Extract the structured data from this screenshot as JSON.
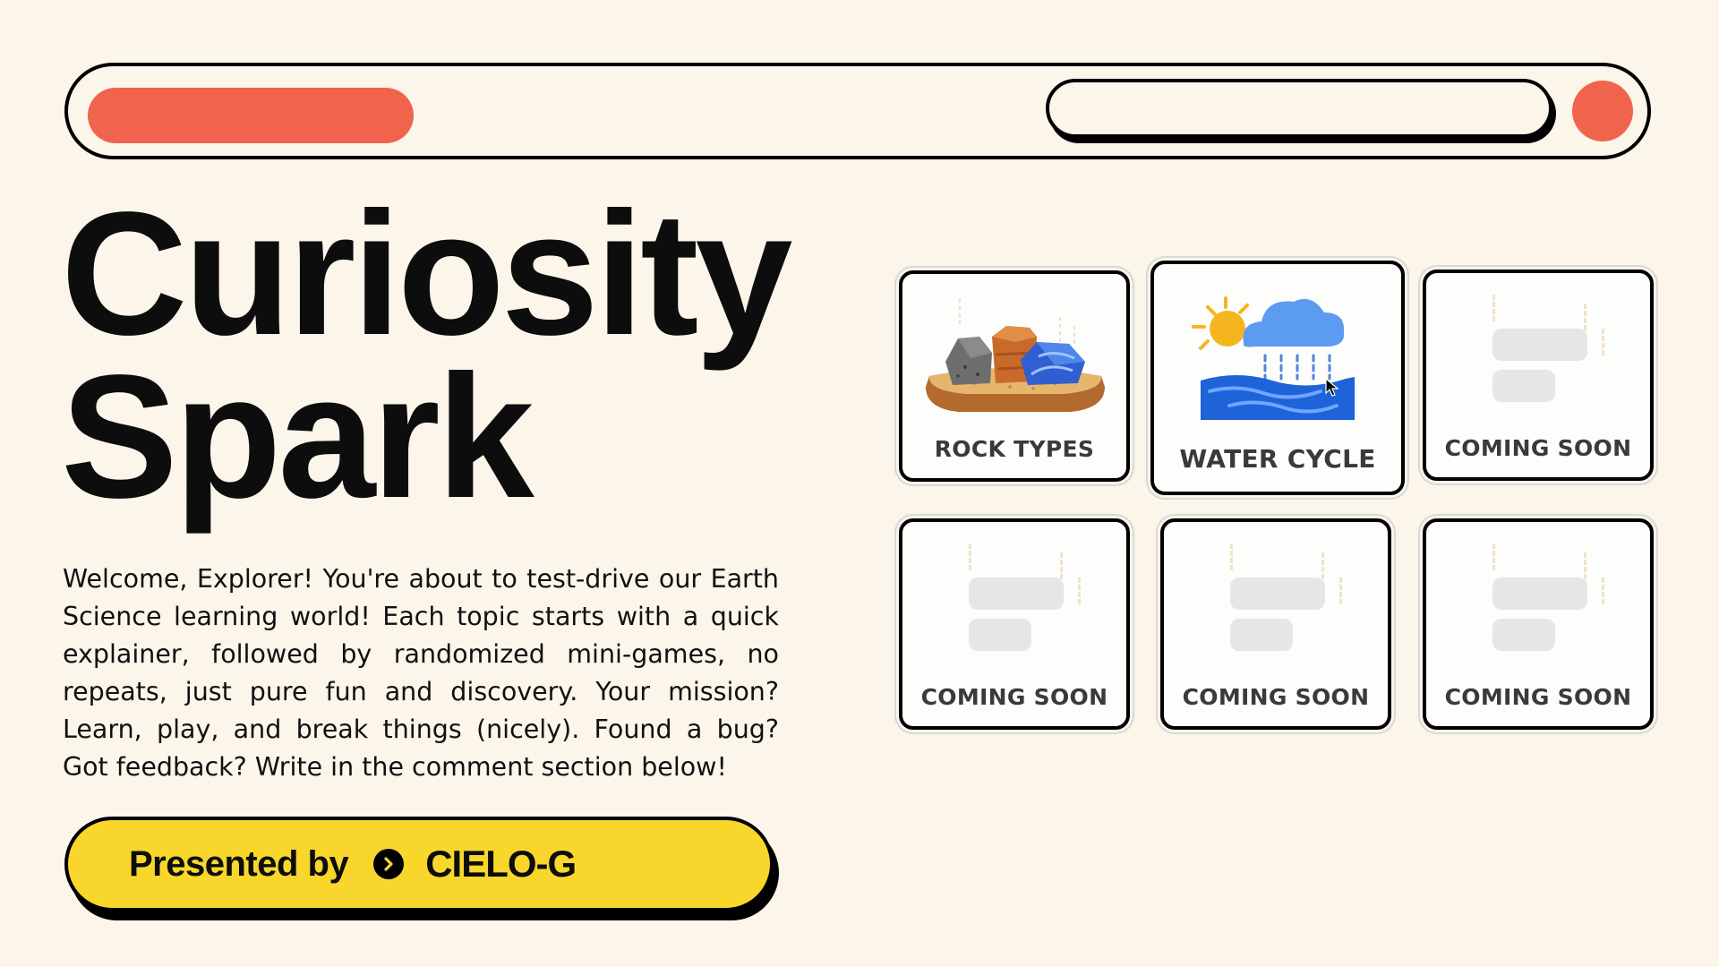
{
  "title_line1": "Curiosity",
  "title_line2": "Spark",
  "intro": "Welcome, Explorer! You're about to test-drive our Earth Science learning world! Each topic starts with a quick explainer, followed by randomized mini-games, no repeats, just pure fun and discovery. Your mission? Learn, play, and break things (nicely). Found a bug? Got feedback? Write in the comment section below!",
  "presented": {
    "label": "Presented by",
    "icon": "chevron-right-circle-icon",
    "name": "CIELO-G"
  },
  "cards": [
    {
      "label": "ROCK TYPES",
      "icon": "rocks-icon"
    },
    {
      "label": "WATER CYCLE",
      "icon": "water-cycle-icon"
    },
    {
      "label": "COMING SOON",
      "icon": "placeholder-icon"
    },
    {
      "label": "COMING SOON",
      "icon": "placeholder-icon"
    },
    {
      "label": "COMING SOON",
      "icon": "placeholder-icon"
    },
    {
      "label": "COMING SOON",
      "icon": "placeholder-icon"
    }
  ],
  "colors": {
    "background": "#fbf5ea",
    "accent": "#f0644d",
    "button": "#f9d62b"
  }
}
